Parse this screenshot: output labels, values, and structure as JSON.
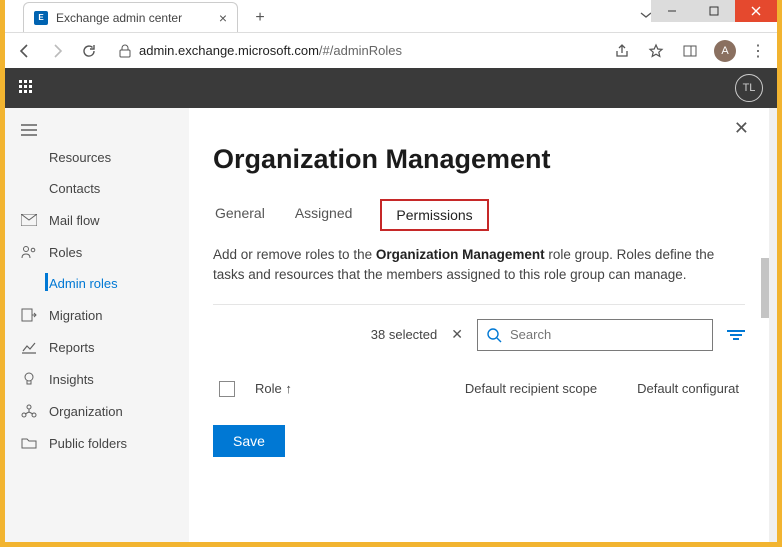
{
  "browser": {
    "tab_title": "Exchange admin center",
    "url_prefix": "admin.exchange.microsoft.com",
    "url_path": "/#/adminRoles",
    "avatar_initial": "A"
  },
  "app": {
    "avatar_initials": "TL"
  },
  "sidebar": {
    "items": [
      {
        "label": "Resources",
        "indent": true
      },
      {
        "label": "Contacts",
        "indent": true
      },
      {
        "label": "Mail flow"
      },
      {
        "label": "Roles"
      },
      {
        "label": "Admin roles",
        "indent": true,
        "active": true
      },
      {
        "label": "Migration"
      },
      {
        "label": "Reports"
      },
      {
        "label": "Insights"
      },
      {
        "label": "Organization"
      },
      {
        "label": "Public folders"
      }
    ]
  },
  "panel": {
    "title": "Organization Management",
    "tabs": {
      "general": "General",
      "assigned": "Assigned",
      "permissions": "Permissions"
    },
    "desc_prefix": "Add or remove roles to the ",
    "desc_bold": "Organization Management",
    "desc_suffix": " role group. Roles define the tasks and resources that the members assigned to this role group can manage.",
    "selected_text": "38 selected",
    "search_placeholder": "Search",
    "columns": {
      "role": "Role",
      "scope": "Default recipient scope",
      "config": "Default configurat"
    },
    "save": "Save"
  }
}
